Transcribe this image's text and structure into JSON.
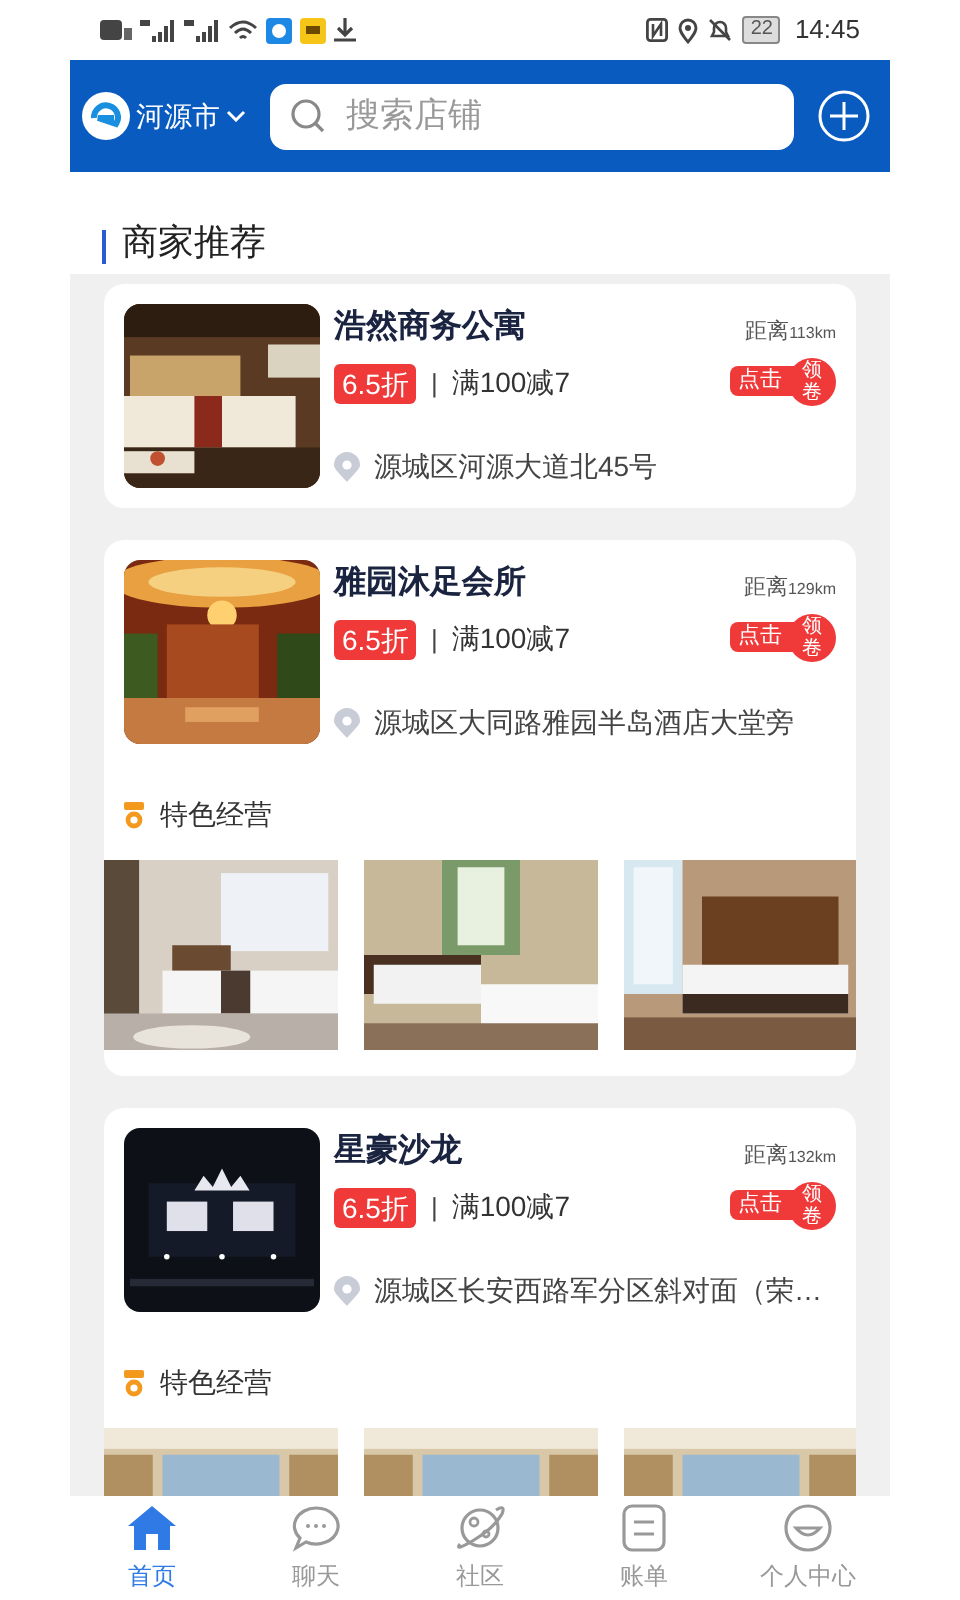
{
  "status_bar": {
    "time": "14:45",
    "battery": "22"
  },
  "header": {
    "city": "河源市",
    "search": {
      "placeholder": "搜索店铺"
    }
  },
  "section_title": "商家推荐",
  "merchants": [
    {
      "name": "浩然商务公寓",
      "discount": "6.5折",
      "separator": "|",
      "offer": "满100减7",
      "distance_label": "距离",
      "distance": "113km",
      "coupon": {
        "action": "点击",
        "label": "领卷"
      },
      "address": "源城区河源大道北45号"
    },
    {
      "name": "雅园沐足会所",
      "discount": "6.5折",
      "separator": "|",
      "offer": "满100减7",
      "distance_label": "距离",
      "distance": "129km",
      "coupon": {
        "action": "点击",
        "label": "领卷"
      },
      "address": "源城区大同路雅园半岛酒店大堂旁",
      "features": {
        "title": "特色经营"
      }
    },
    {
      "name": "星豪沙龙",
      "discount": "6.5折",
      "separator": "|",
      "offer": "满100减7",
      "distance_label": "距离",
      "distance": "132km",
      "coupon": {
        "action": "点击",
        "label": "领卷"
      },
      "address": "源城区长安西路军分区斜对面（荣…",
      "features": {
        "title": "特色经营"
      }
    }
  ],
  "tabs": [
    {
      "label": "首页",
      "selected": true
    },
    {
      "label": "聊天",
      "selected": false
    },
    {
      "label": "社区",
      "selected": false
    },
    {
      "label": "账单",
      "selected": false
    },
    {
      "label": "个人中心",
      "selected": false
    }
  ]
}
